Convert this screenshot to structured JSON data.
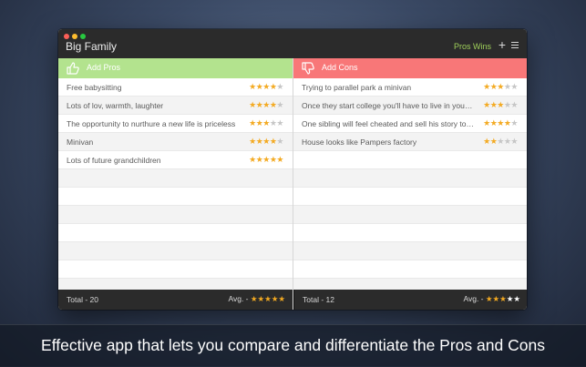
{
  "app": {
    "title": "Big Family",
    "winner_label": "Pros Wins",
    "add_icon": "plus-icon",
    "menu_icon": "hamburger-menu-icon"
  },
  "pros": {
    "header_label": "Add Pros",
    "header_icon": "thumbs-up-icon",
    "header_color": "#b3e38e",
    "items": [
      {
        "text": "Free babysitting",
        "rating": 4
      },
      {
        "text": "Lots of lov, warmth, laughter",
        "rating": 4
      },
      {
        "text": "The opportunity to nurthure a new life is priceless",
        "rating": 3
      },
      {
        "text": "Minivan",
        "rating": 4
      },
      {
        "text": "Lots of future grandchildren",
        "rating": 5
      }
    ],
    "total_label": "Total - 20",
    "avg_label": "Avg. -",
    "avg_rating": 5
  },
  "cons": {
    "header_label": "Add Cons",
    "header_icon": "thumbs-down-icon",
    "header_color": "#f87778",
    "items": [
      {
        "text": "Trying to parallel park a minivan",
        "rating": 3
      },
      {
        "text": "Once they start college you'll have to live in your car",
        "rating": 3
      },
      {
        "text": "One sibling will feel cheated and sell his story to…",
        "rating": 4
      },
      {
        "text": "House looks like Pampers factory",
        "rating": 2
      }
    ],
    "total_label": "Total - 12",
    "avg_label": "Avg. -",
    "avg_rating": 3
  },
  "star_color": "#f3aa22",
  "caption": "Effective app that lets you compare and differentiate the Pros and Cons"
}
